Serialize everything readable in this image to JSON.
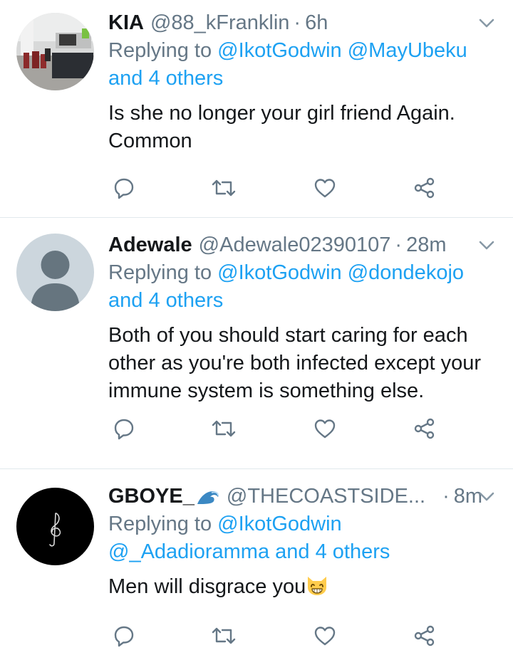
{
  "tweets": [
    {
      "name": "KIA",
      "handle": "@88_kFranklin",
      "dot": "·",
      "time": "6h",
      "replying_prefix": "Replying to",
      "replying_links": [
        "@IkotGodwin",
        "@MayUbeku",
        "and 4 others"
      ],
      "text": "Is she no longer your girl friend Again. Common",
      "avatar_icon": "room-photo"
    },
    {
      "name": "Adewale",
      "handle": "@Adewale02390107",
      "dot": "·",
      "time": "28m",
      "replying_prefix": "Replying to",
      "replying_links": [
        "@IkotGodwin",
        "@dondekojo",
        "and 4 others"
      ],
      "text": "Both of you should start caring for each other as you're both infected except your immune system is something else.",
      "avatar_icon": "default-person"
    },
    {
      "name": "GBOYE_",
      "name_emoji": "wave-emoji",
      "handle": "@THECOASTSIDE...",
      "dot": "·",
      "time": "8m",
      "replying_prefix": "Replying to",
      "replying_links": [
        "@IkotGodwin",
        "@_Adadioramma",
        "and 4 others"
      ],
      "text": "Men will disgrace you",
      "text_emoji": "grinning-cat-emoji",
      "avatar_icon": "treble-clef"
    }
  ],
  "actions": [
    "reply-icon",
    "retweet-icon",
    "like-icon",
    "share-icon"
  ],
  "colors": {
    "link": "#1da1f2",
    "secondary": "#657786",
    "text": "#14171a",
    "divider": "#e1e8ed"
  }
}
